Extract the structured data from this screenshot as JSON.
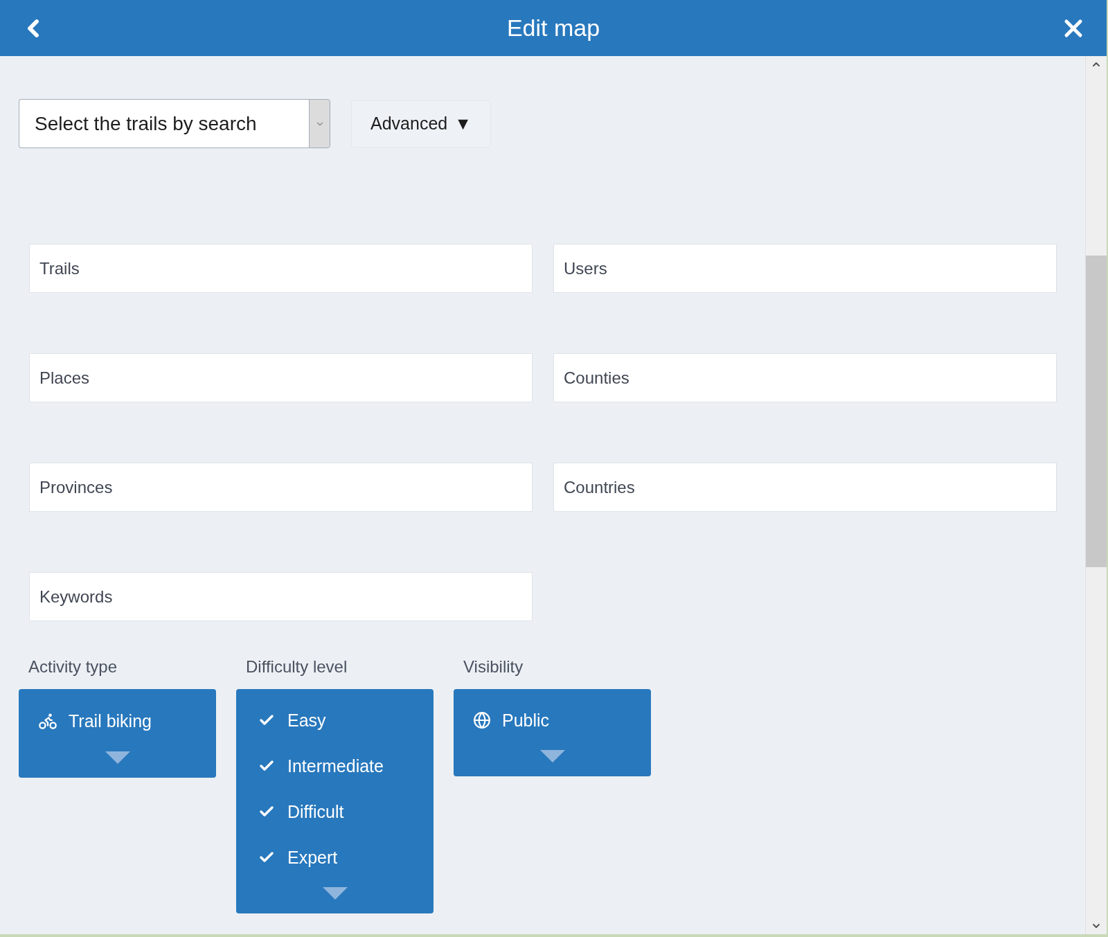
{
  "header": {
    "title": "Edit map"
  },
  "search": {
    "placeholder": "Select the trails by search"
  },
  "advanced_button": {
    "label": "Advanced",
    "caret": "▼"
  },
  "fields": [
    {
      "placeholder": "Trails"
    },
    {
      "placeholder": "Users"
    },
    {
      "placeholder": "Places"
    },
    {
      "placeholder": "Counties"
    },
    {
      "placeholder": "Provinces"
    },
    {
      "placeholder": "Countries"
    },
    {
      "placeholder": "Keywords"
    }
  ],
  "filters": [
    {
      "label": "Activity type",
      "kind": "activity",
      "value": "Trail biking"
    },
    {
      "label": "Difficulty level",
      "kind": "multi",
      "options": [
        {
          "label": "Easy",
          "checked": true
        },
        {
          "label": "Intermediate",
          "checked": true
        },
        {
          "label": "Difficult",
          "checked": true
        },
        {
          "label": "Expert",
          "checked": true
        }
      ]
    },
    {
      "label": "Visibility",
      "kind": "visibility",
      "value": "Public"
    }
  ]
}
